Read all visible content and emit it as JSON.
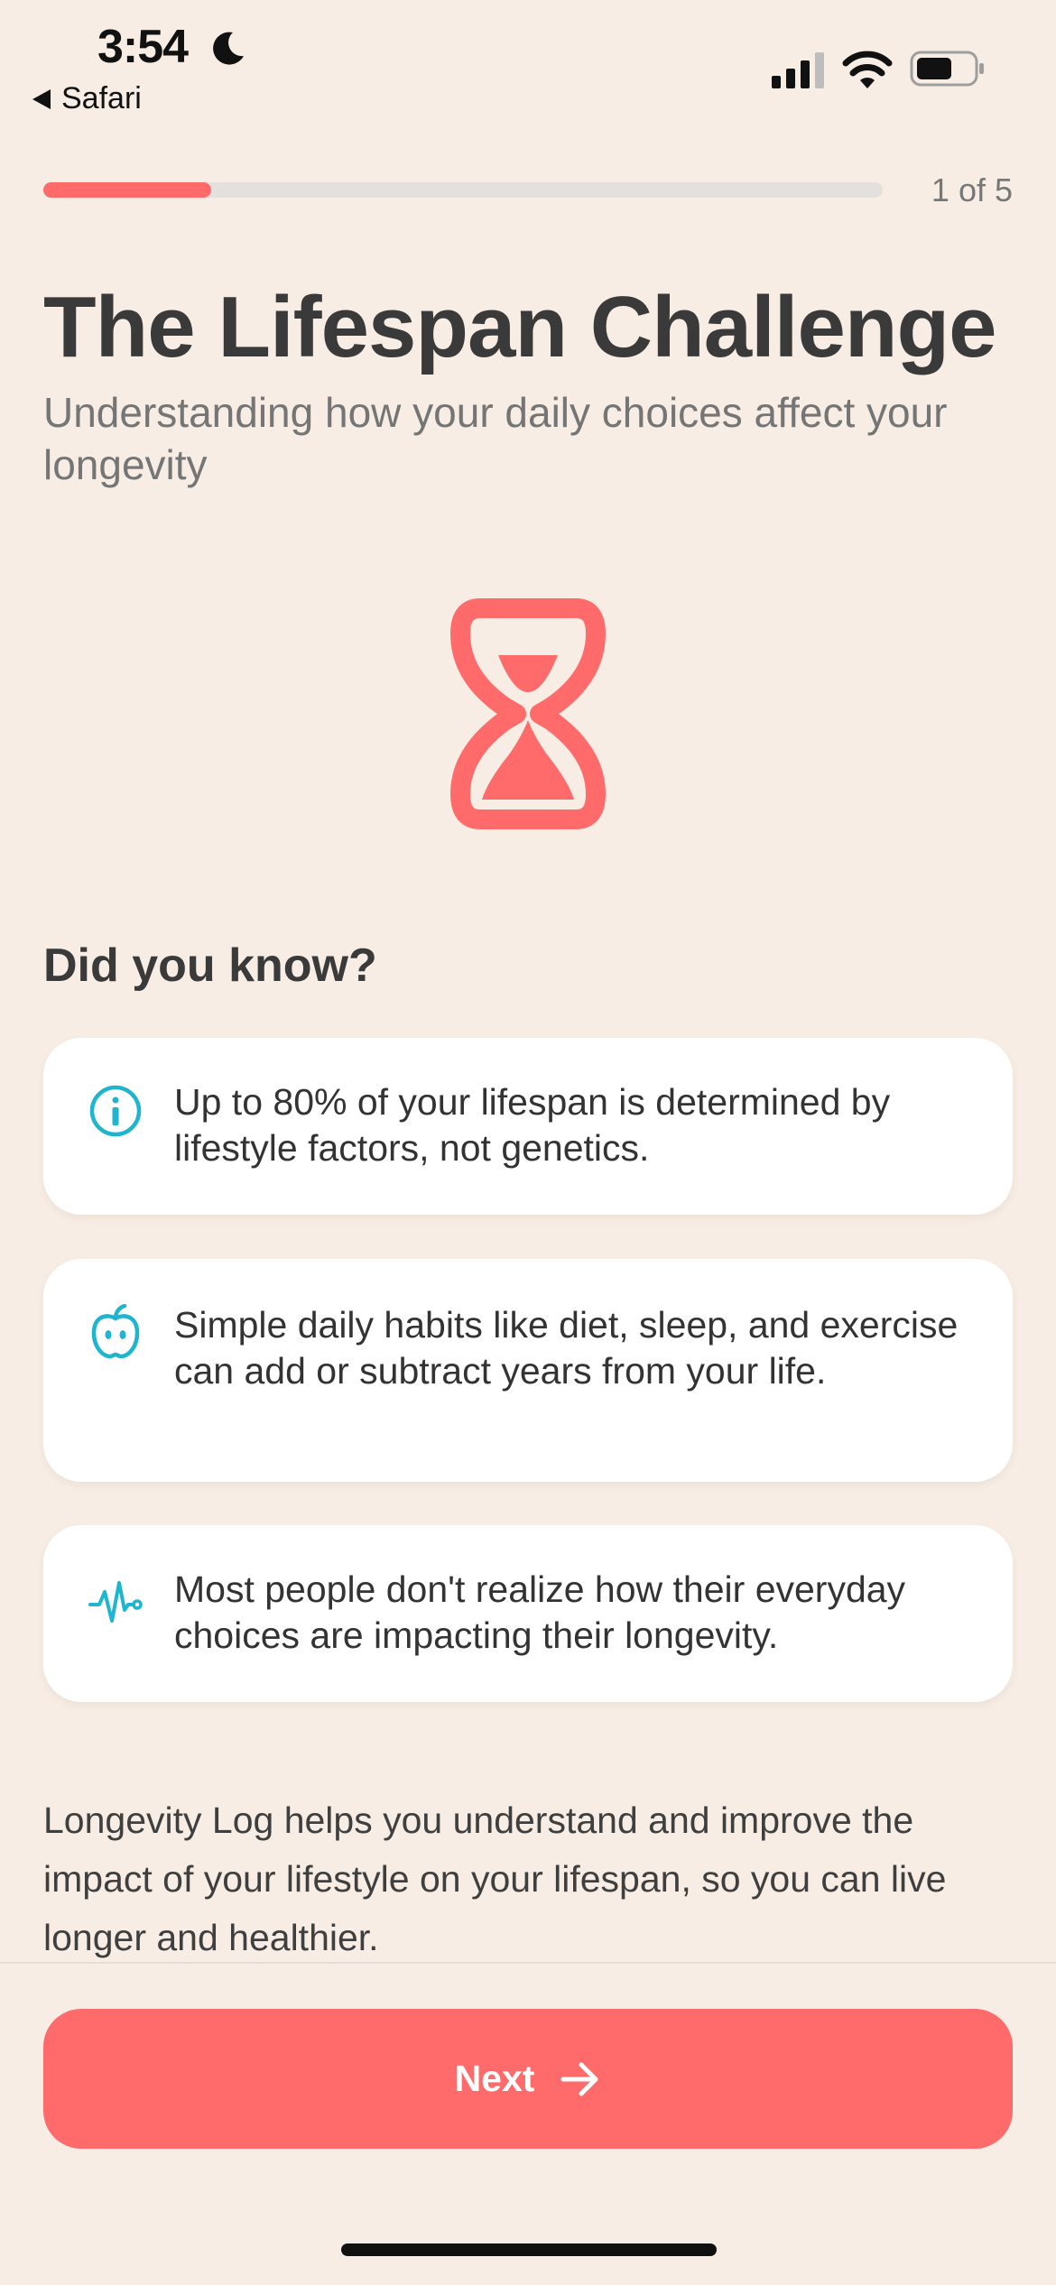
{
  "status_bar": {
    "time": "3:54",
    "back_label": "Safari",
    "icons": [
      "moon-icon",
      "cellular-signal-icon",
      "wifi-icon",
      "battery-icon"
    ]
  },
  "progress": {
    "current_step": 1,
    "total_steps": 5,
    "counter_text": "1 of 5",
    "fill_fraction": 0.2
  },
  "header": {
    "title": "The Lifespan Challenge",
    "subtitle": "Understanding how your daily choices affect your longevity"
  },
  "hero": {
    "icon": "hourglass-icon"
  },
  "facts": {
    "heading": "Did you know?",
    "items": [
      {
        "icon": "info-icon",
        "text": "Up to 80% of your lifespan is determined by lifestyle factors, not genetics."
      },
      {
        "icon": "apple-icon",
        "text": "Simple daily habits like diet, sleep, and exercise can add or subtract years from your life."
      },
      {
        "icon": "heartbeat-icon",
        "text": "Most people don't realize how their everyday choices are impacting their longevity."
      }
    ]
  },
  "description": "Longevity Log helps you understand and improve the impact of your lifestyle on your lifespan, so you can live longer and healthier.",
  "footer": {
    "next_label": "Next",
    "next_icon": "arrow-right-icon"
  },
  "colors": {
    "background": "#F7EDE4",
    "accent": "#FF6B6B",
    "icon_teal": "#1FB5CE",
    "track": "#E3E0DD",
    "title": "#3A3A3A"
  }
}
